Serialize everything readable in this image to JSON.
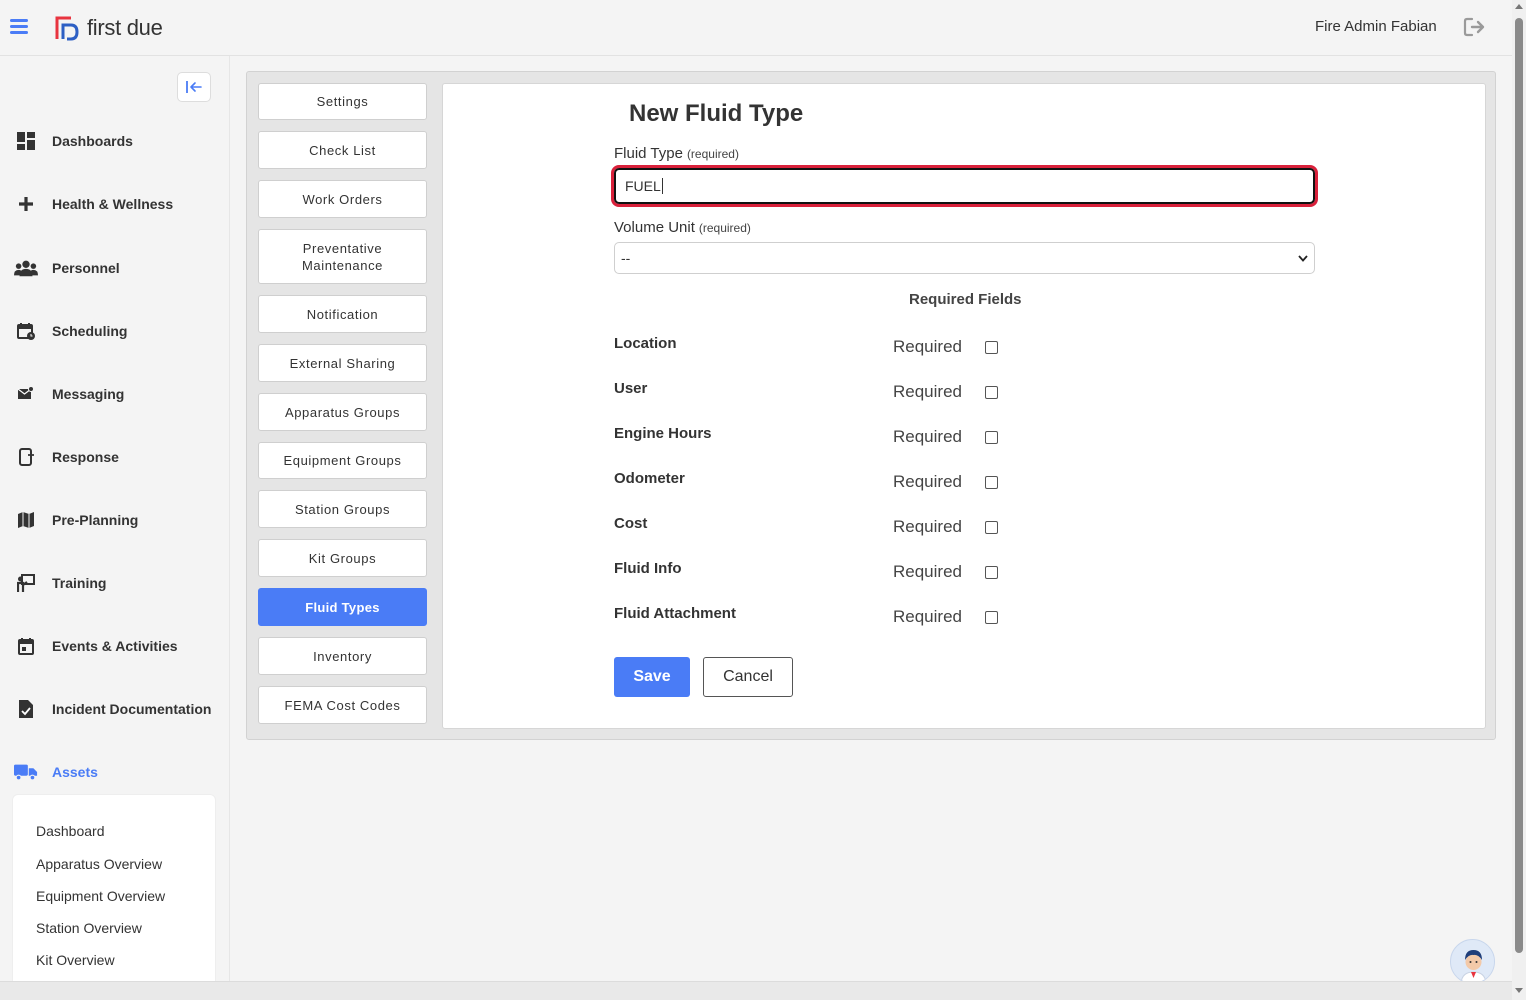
{
  "header": {
    "brand": "first due",
    "user_name": "Fire Admin Fabian"
  },
  "sidebar": {
    "items": [
      {
        "label": "Dashboards",
        "icon": "dashboard-icon"
      },
      {
        "label": "Health & Wellness",
        "icon": "plus-icon"
      },
      {
        "label": "Personnel",
        "icon": "users-icon"
      },
      {
        "label": "Scheduling",
        "icon": "calendar-clock-icon"
      },
      {
        "label": "Messaging",
        "icon": "mail-icon"
      },
      {
        "label": "Response",
        "icon": "phone-icon"
      },
      {
        "label": "Pre-Planning",
        "icon": "map-icon"
      },
      {
        "label": "Training",
        "icon": "training-icon"
      },
      {
        "label": "Events & Activities",
        "icon": "calendar-icon"
      },
      {
        "label": "Incident Documentation",
        "icon": "document-check-icon"
      },
      {
        "label": "Assets",
        "icon": "truck-icon",
        "active": true
      }
    ],
    "assets_subnav": [
      "Dashboard",
      "Apparatus Overview",
      "Equipment Overview",
      "Station Overview",
      "Kit Overview"
    ]
  },
  "tabs": [
    "Settings",
    "Check List",
    "Work Orders",
    "Preventative Maintenance",
    "Notification",
    "External Sharing",
    "Apparatus Groups",
    "Equipment Groups",
    "Station Groups",
    "Kit Groups",
    "Fluid Types",
    "Inventory",
    "FEMA Cost Codes"
  ],
  "active_tab": "Fluid Types",
  "form": {
    "title": "New Fluid Type",
    "fluid_type_label": "Fluid Type",
    "fluid_type_required": "(required)",
    "fluid_type_value": "FUEL",
    "volume_unit_label": "Volume Unit",
    "volume_unit_required": "(required)",
    "volume_unit_value": "--",
    "required_fields_heading": "Required Fields",
    "required_word": "Required",
    "required_rows": [
      "Location",
      "User",
      "Engine Hours",
      "Odometer",
      "Cost",
      "Fluid Info",
      "Fluid Attachment"
    ],
    "save_label": "Save",
    "cancel_label": "Cancel"
  },
  "colors": {
    "accent": "#4a7cf6",
    "focus_ring": "#d9213b",
    "logo_red": "#e8343f"
  }
}
